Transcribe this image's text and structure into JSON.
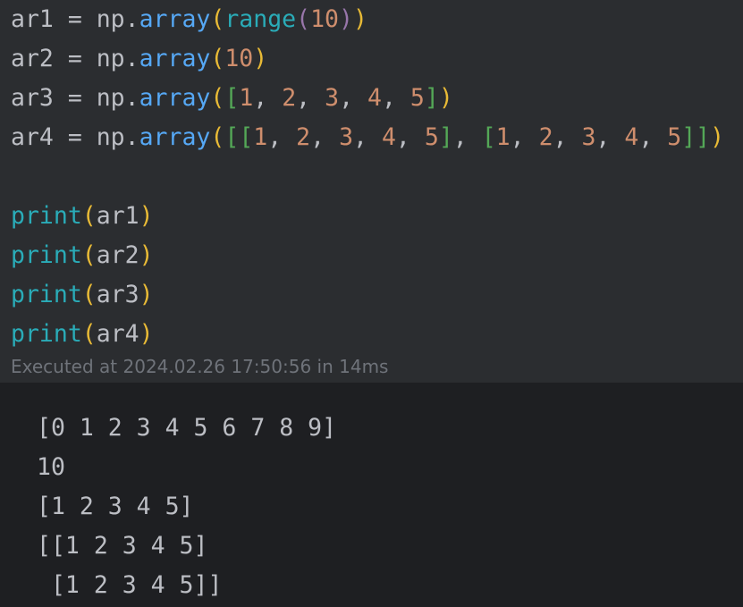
{
  "code_cell": {
    "lines": [
      {
        "tokens": [
          {
            "text": "ar1 = np.",
            "color": "#bcbec4"
          },
          {
            "text": "array",
            "color": "#56a8f5"
          },
          {
            "text": "(",
            "color": "#e8ba36"
          },
          {
            "text": "range",
            "color": "#2aacb8"
          },
          {
            "text": "(",
            "color": "#9876aa"
          },
          {
            "text": "10",
            "color": "#cf8e6d"
          },
          {
            "text": ")",
            "color": "#9876aa"
          },
          {
            "text": ")",
            "color": "#e8ba36"
          }
        ]
      },
      {
        "tokens": [
          {
            "text": "ar2 = np.",
            "color": "#bcbec4"
          },
          {
            "text": "array",
            "color": "#56a8f5"
          },
          {
            "text": "(",
            "color": "#e8ba36"
          },
          {
            "text": "10",
            "color": "#cf8e6d"
          },
          {
            "text": ")",
            "color": "#e8ba36"
          }
        ]
      },
      {
        "tokens": [
          {
            "text": "ar3 = np.",
            "color": "#bcbec4"
          },
          {
            "text": "array",
            "color": "#56a8f5"
          },
          {
            "text": "(",
            "color": "#e8ba36"
          },
          {
            "text": "[",
            "color": "#54a857"
          },
          {
            "text": "1",
            "color": "#cf8e6d"
          },
          {
            "text": ", ",
            "color": "#bcbec4"
          },
          {
            "text": "2",
            "color": "#cf8e6d"
          },
          {
            "text": ", ",
            "color": "#bcbec4"
          },
          {
            "text": "3",
            "color": "#cf8e6d"
          },
          {
            "text": ", ",
            "color": "#bcbec4"
          },
          {
            "text": "4",
            "color": "#cf8e6d"
          },
          {
            "text": ", ",
            "color": "#bcbec4"
          },
          {
            "text": "5",
            "color": "#cf8e6d"
          },
          {
            "text": "]",
            "color": "#54a857"
          },
          {
            "text": ")",
            "color": "#e8ba36"
          }
        ]
      },
      {
        "tokens": [
          {
            "text": "ar4 = np.",
            "color": "#bcbec4"
          },
          {
            "text": "array",
            "color": "#56a8f5"
          },
          {
            "text": "(",
            "color": "#e8ba36"
          },
          {
            "text": "[",
            "color": "#54a857"
          },
          {
            "text": "[",
            "color": "#54a857"
          },
          {
            "text": "1",
            "color": "#cf8e6d"
          },
          {
            "text": ", ",
            "color": "#bcbec4"
          },
          {
            "text": "2",
            "color": "#cf8e6d"
          },
          {
            "text": ", ",
            "color": "#bcbec4"
          },
          {
            "text": "3",
            "color": "#cf8e6d"
          },
          {
            "text": ", ",
            "color": "#bcbec4"
          },
          {
            "text": "4",
            "color": "#cf8e6d"
          },
          {
            "text": ", ",
            "color": "#bcbec4"
          },
          {
            "text": "5",
            "color": "#cf8e6d"
          },
          {
            "text": "]",
            "color": "#54a857"
          },
          {
            "text": ", ",
            "color": "#bcbec4"
          },
          {
            "text": "[",
            "color": "#54a857"
          },
          {
            "text": "1",
            "color": "#cf8e6d"
          },
          {
            "text": ", ",
            "color": "#bcbec4"
          },
          {
            "text": "2",
            "color": "#cf8e6d"
          },
          {
            "text": ", ",
            "color": "#bcbec4"
          },
          {
            "text": "3",
            "color": "#cf8e6d"
          },
          {
            "text": ", ",
            "color": "#bcbec4"
          },
          {
            "text": "4",
            "color": "#cf8e6d"
          },
          {
            "text": ", ",
            "color": "#bcbec4"
          },
          {
            "text": "5",
            "color": "#cf8e6d"
          },
          {
            "text": "]",
            "color": "#54a857"
          },
          {
            "text": "]",
            "color": "#54a857"
          },
          {
            "text": ")",
            "color": "#e8ba36"
          }
        ]
      },
      {
        "tokens": []
      },
      {
        "tokens": [
          {
            "text": "print",
            "color": "#2aacb8"
          },
          {
            "text": "(",
            "color": "#e8ba36"
          },
          {
            "text": "ar1",
            "color": "#bcbec4"
          },
          {
            "text": ")",
            "color": "#e8ba36"
          }
        ]
      },
      {
        "tokens": [
          {
            "text": "print",
            "color": "#2aacb8"
          },
          {
            "text": "(",
            "color": "#e8ba36"
          },
          {
            "text": "ar2",
            "color": "#bcbec4"
          },
          {
            "text": ")",
            "color": "#e8ba36"
          }
        ]
      },
      {
        "tokens": [
          {
            "text": "print",
            "color": "#2aacb8"
          },
          {
            "text": "(",
            "color": "#e8ba36"
          },
          {
            "text": "ar3",
            "color": "#bcbec4"
          },
          {
            "text": ")",
            "color": "#e8ba36"
          }
        ]
      },
      {
        "tokens": [
          {
            "text": "print",
            "color": "#2aacb8"
          },
          {
            "text": "(",
            "color": "#e8ba36"
          },
          {
            "text": "ar4",
            "color": "#bcbec4"
          },
          {
            "text": ")",
            "color": "#e8ba36"
          }
        ]
      }
    ]
  },
  "execution": {
    "status_text": "Executed at 2024.02.26 17:50:56 in 14ms"
  },
  "output": {
    "lines": [
      "[0 1 2 3 4 5 6 7 8 9]",
      "10",
      "[1 2 3 4 5]",
      "[[1 2 3 4 5]",
      " [1 2 3 4 5]]"
    ]
  },
  "colors": {
    "cell_background": "#2b2d30",
    "output_background": "#1e1f22",
    "default_text": "#bcbec4",
    "muted_text": "#6f737a"
  }
}
